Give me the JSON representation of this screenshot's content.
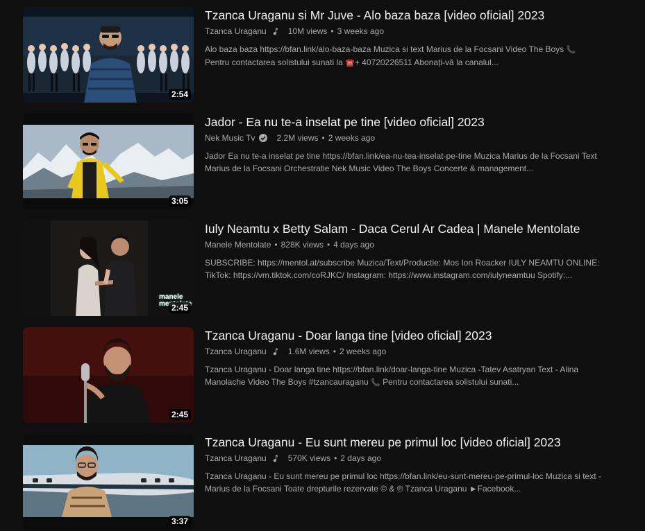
{
  "videos": [
    {
      "title": "Tzanca Uraganu si Mr Juve - Alo baza baza [video oficial] 2023",
      "channel": "Tzanca Uraganu",
      "badge": "music-note-icon",
      "views": "10M views",
      "age": "3 weeks ago",
      "duration": "2:54",
      "desc_a": "Alo baza baza https://bfan.link/alo-baza-baza Muzica si text Marius de la Focsani Video The Boys",
      "emoji_a": "📞",
      "desc_b": "Pentru contactarea solistului sunati la",
      "emoji_b": "☎️",
      "desc_c": "+ 40720226511 Abonați-vă la canalul..."
    },
    {
      "title": "Jador - Ea nu te-a inselat pe tine [video oficial] 2023",
      "channel": "Nek Music Tv",
      "badge": "verified-check-icon",
      "views": "2.2M views",
      "age": "2 weeks ago",
      "duration": "3:05",
      "desc_a": "Jador Ea nu te-a inselat pe tine https://bfan.link/ea-nu-tea-inselat-pe-tine Muzica Marius de la Focsani Text Marius de la Focsani Orchestratie Nek Music Video The Boys Concerte & management...",
      "emoji_a": "",
      "desc_b": "",
      "emoji_b": "",
      "desc_c": ""
    },
    {
      "title": "Iuly Neamtu x Betty Salam - Daca Cerul Ar Cadea | Manele Mentolate",
      "channel": "Manele Mentolate",
      "badge": "",
      "views": "828K views",
      "age": "4 days ago",
      "duration": "2:45",
      "desc_a": "SUBSCRIBE: https://mentol.at/subscribe Muzica/Text/Productie: Mos Ion Roacker IULY NEAMTU ONLINE: TikTok: https://vm.tiktok.com/coRJKC/ Instagram: https://www.instagram.com/iulyneamtuu Spotify:...",
      "emoji_a": "",
      "desc_b": "",
      "emoji_b": "",
      "desc_c": ""
    },
    {
      "title": "Tzanca Uraganu - Doar langa tine [video oficial] 2023",
      "channel": "Tzanca Uraganu",
      "badge": "music-note-icon",
      "views": "1.6M views",
      "age": "2 weeks ago",
      "duration": "2:45",
      "desc_a": "Tzanca Uraganu - Doar langa tine https://bfan.link/doar-langa-tine Muzica -Tatev Asatryan Text - Alina Manolache Video The Boys #tzancauraganu",
      "emoji_a": "📞",
      "desc_b": "Pentru contactarea solistului sunati...",
      "emoji_b": "",
      "desc_c": ""
    },
    {
      "title": "Tzanca Uraganu - Eu sunt mereu pe primul loc [video oficial] 2023",
      "channel": "Tzanca Uraganu",
      "badge": "music-note-icon",
      "views": "570K views",
      "age": "2 days ago",
      "duration": "3:37",
      "desc_a": "Tzanca Uraganu - Eu sunt mereu pe primul loc https://bfan.link/eu-sunt-mereu-pe-primul-loc Muzica si text - Marius de la Focsani Toate drepturile rezervate © & ℗ Tzanca Uraganu ►Facebook...",
      "emoji_a": "",
      "desc_b": "",
      "emoji_b": "",
      "desc_c": ""
    }
  ],
  "thumb_overlay_text": "manele mentolate",
  "colors": {
    "background": "#0f0f0f",
    "text_primary": "#f1f1f1",
    "text_secondary": "#aaaaaa",
    "phone_red": "#e33b3b"
  }
}
